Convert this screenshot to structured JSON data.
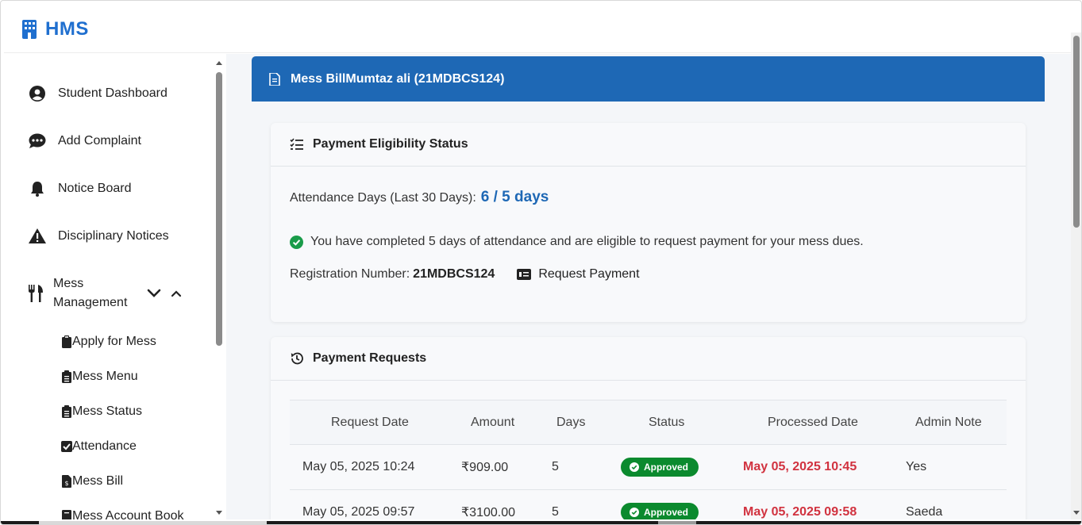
{
  "app": {
    "name": "HMS"
  },
  "sidebar": {
    "items": [
      {
        "label": "Student Dashboard",
        "icon": "user-circle-icon"
      },
      {
        "label": "Add Complaint",
        "icon": "comment-dots-icon"
      },
      {
        "label": "Notice Board",
        "icon": "bell-icon"
      },
      {
        "label": "Disciplinary Notices",
        "icon": "warning-triangle-icon"
      }
    ],
    "mess_management": {
      "label": "Mess Management",
      "icon": "utensils-icon",
      "sub_items": [
        {
          "label": "Apply for Mess",
          "icon": "clipboard-icon"
        },
        {
          "label": "Mess Menu",
          "icon": "clipboard-list-icon"
        },
        {
          "label": "Mess Status",
          "icon": "clipboard-list-icon"
        },
        {
          "label": "Attendance",
          "icon": "check-square-icon"
        },
        {
          "label": "Mess Bill",
          "icon": "file-invoice-dollar-icon"
        },
        {
          "label": "Mess Account Book",
          "icon": "book-icon"
        }
      ]
    }
  },
  "main": {
    "header": {
      "title": "Mess BillMumtaz ali (21MDBCS124)",
      "icon": "file-icon"
    },
    "eligibility": {
      "title": "Payment Eligibility Status",
      "attendance_label": "Attendance Days (Last 30 Days):",
      "attendance_value": "6 / 5 days",
      "message": "You have completed 5 days of attendance and are eligible to request payment for your mess dues.",
      "registration_label": "Registration Number:",
      "registration_value": "21MDBCS124",
      "request_button": "Request Payment"
    },
    "requests": {
      "title": "Payment Requests",
      "columns": [
        "Request Date",
        "Amount",
        "Days",
        "Status",
        "Processed Date",
        "Admin Note"
      ],
      "rows": [
        {
          "request_date": "May 05, 2025 10:24",
          "amount": "₹909.00",
          "days": "5",
          "status": "Approved",
          "processed_date": "May 05, 2025 10:45",
          "note": "Yes"
        },
        {
          "request_date": "May 05, 2025 09:57",
          "amount": "₹3100.00",
          "days": "5",
          "status": "Approved",
          "processed_date": "May 05, 2025 09:58",
          "note": "Saeda"
        }
      ]
    }
  },
  "colors": {
    "brand": "#1f6fcf",
    "banner": "#1e68b5",
    "approved": "#0b8a2e",
    "processed": "#d1323f"
  }
}
